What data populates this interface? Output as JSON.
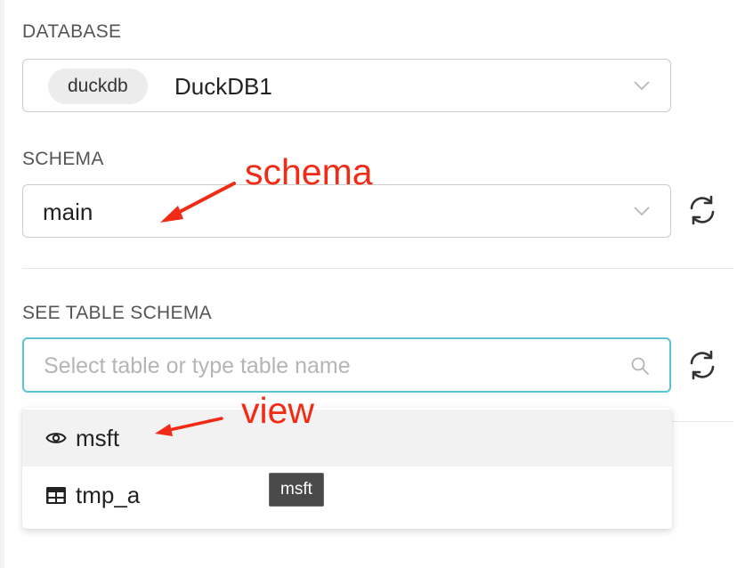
{
  "database": {
    "label": "DATABASE",
    "backend_badge": "duckdb",
    "selected": "DuckDB1",
    "chevron_icon": "chevron-down-icon"
  },
  "schema": {
    "label": "SCHEMA",
    "selected": "main",
    "chevron_icon": "chevron-down-icon",
    "refresh_icon": "refresh-icon"
  },
  "table_schema": {
    "label": "SEE TABLE SCHEMA",
    "placeholder": "Select table or type table name",
    "search_icon": "search-icon",
    "refresh_icon": "refresh-icon",
    "options": [
      {
        "icon": "eye-icon",
        "label": "msft",
        "active": true
      },
      {
        "icon": "table-icon",
        "label": "tmp_a",
        "active": false
      }
    ],
    "tooltip": "msft"
  },
  "annotations": {
    "schema_note": "schema",
    "view_note": "view",
    "color": "#f22b17"
  },
  "colors": {
    "focus_border": "#5bc4d1",
    "tooltip_bg": "#4a4a4a"
  }
}
